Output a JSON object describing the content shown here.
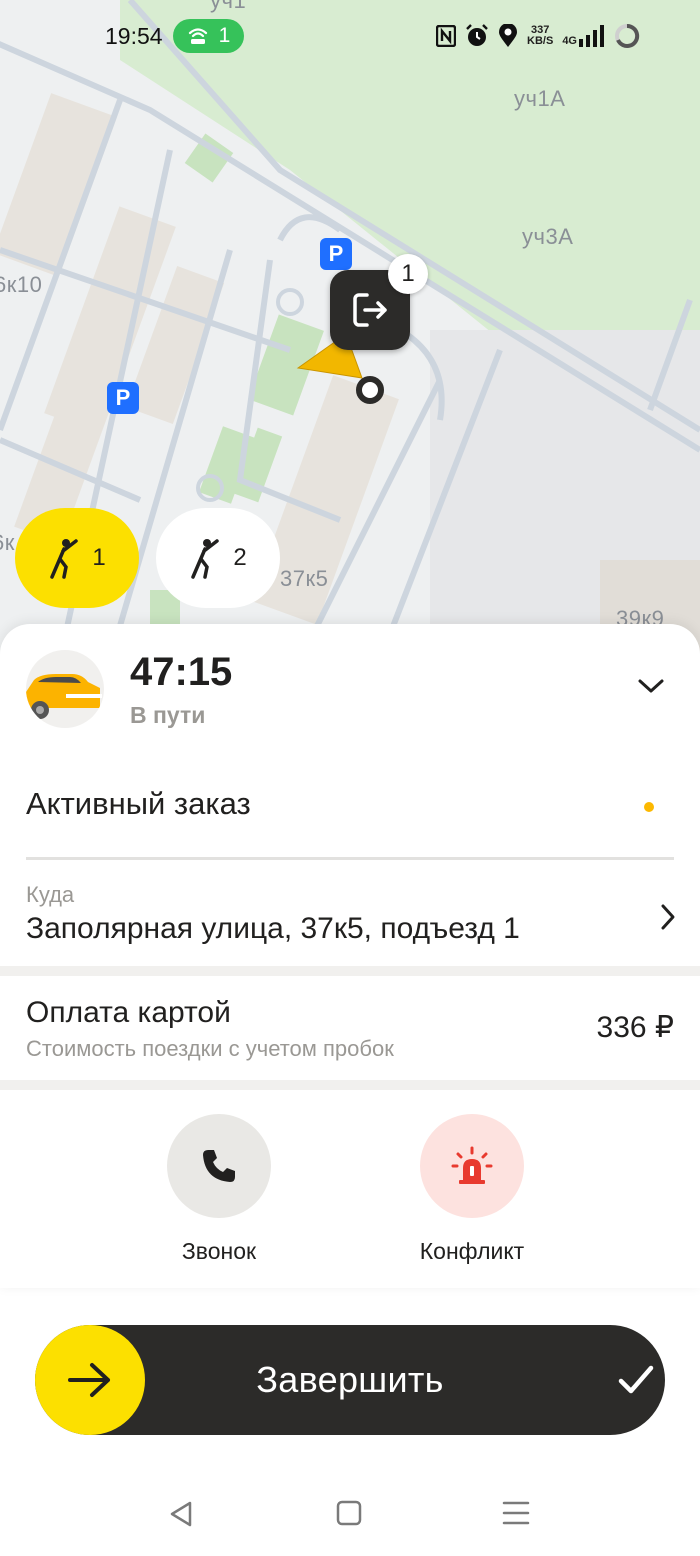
{
  "status_bar": {
    "time": "19:54",
    "hotspot_count": "1",
    "speed_value": "337",
    "speed_unit": "KB/S",
    "network": "4G",
    "icons": [
      "nfc-icon",
      "alarm-icon",
      "location-icon",
      "signal-icon",
      "battery-icon"
    ]
  },
  "map": {
    "labels": [
      "уч1",
      "уч1А",
      "уч3А",
      "6к10",
      "6к",
      "37к5",
      "39к9"
    ],
    "parking_label": "P",
    "pin_badge": "1",
    "icons": [
      "exit-icon",
      "navigation-arrow-icon",
      "parking-icon"
    ]
  },
  "chips": [
    {
      "count": "1",
      "icon": "passenger-icon",
      "active": true
    },
    {
      "count": "2",
      "icon": "passenger-icon",
      "active": false
    }
  ],
  "trip": {
    "eta": "47:15",
    "status": "В пути",
    "active_order": "Активный заказ",
    "dest_label": "Куда",
    "dest_value": "Заполярная улица, 37к5, подъезд 1"
  },
  "payment": {
    "title": "Оплата картой",
    "subtitle": "Стоимость поездки с учетом пробок",
    "amount": "336 ₽"
  },
  "actions": {
    "call": "Звонок",
    "conflict": "Конфликт"
  },
  "finish": {
    "label": "Завершить"
  },
  "colors": {
    "accent_yellow": "#fce000",
    "dark": "#2c2b29",
    "conflict_red": "#e83a2f",
    "parking_blue": "#1f6fff",
    "green_area": "#d8ecd1"
  }
}
